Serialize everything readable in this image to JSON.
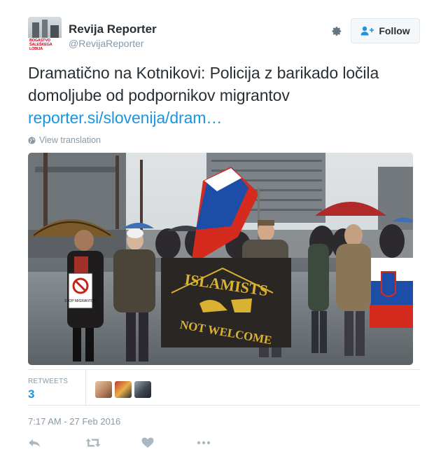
{
  "tweet": {
    "author_name": "Revija Reporter",
    "author_handle": "@RevijaReporter",
    "avatar_caption_line1": "BOGASTVO",
    "avatar_caption_line2": "ŠALEŠKEGA LOBIJA",
    "text": "Dramatično na Kotnikovi: Policija z barikado ločila domoljube od podpornikov migrantov",
    "link": "reporter.si/slovenija/dram…",
    "view_translation": "View translation",
    "timestamp": "7:17 AM - 27 Feb 2016"
  },
  "follow_button": {
    "label": "Follow"
  },
  "photo": {
    "banner_top": "ISLAMISTS",
    "banner_bottom": "NOT WELCOME",
    "sign_text": "STOP MIGRANTOM"
  },
  "stats": {
    "retweets_label": "RETWEETS",
    "retweets_count": "3"
  },
  "icons": {
    "settings": "gear-icon",
    "follow": "add-user-icon",
    "translate": "globe-icon",
    "reply": "reply-icon",
    "retweet": "retweet-icon",
    "like": "heart-icon",
    "more": "more-dots-icon"
  },
  "colors": {
    "link": "#1b95e0",
    "secondary_text": "#8899a6",
    "primary_text": "#292f33",
    "border": "#e1e8ed"
  }
}
